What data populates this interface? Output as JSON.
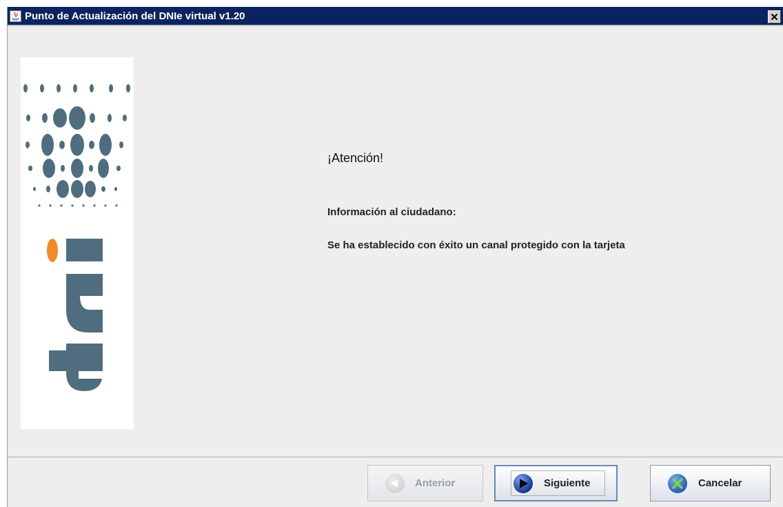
{
  "window": {
    "title": "Punto de Actualización del DNIe virtual v1.20"
  },
  "logo": {
    "text": "dni"
  },
  "content": {
    "heading": "¡Atención!",
    "subheading": "Información al ciudadano:",
    "message": "Se ha establecido con éxito un canal protegido con la tarjeta"
  },
  "buttons": {
    "previous_label": "Anterior",
    "next_label": "Siguiente",
    "cancel_label": "Cancelar"
  },
  "colors": {
    "titlebar": "#0b2460",
    "logo_accent": "#f08a2a",
    "logo_main": "#4f6d7e"
  }
}
